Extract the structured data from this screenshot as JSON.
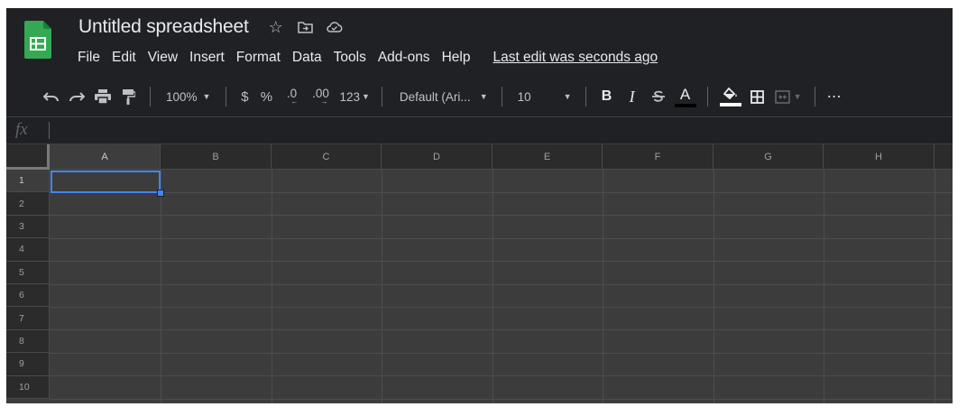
{
  "app": {
    "title": "Untitled spreadsheet",
    "last_edit": "Last edit was seconds ago",
    "accent_color": "#34a853"
  },
  "menu": {
    "items": [
      "File",
      "Edit",
      "View",
      "Insert",
      "Format",
      "Data",
      "Tools",
      "Add-ons",
      "Help"
    ]
  },
  "toolbar": {
    "zoom": "100%",
    "currency": "$",
    "percent": "%",
    "decrease_decimal": ".0",
    "increase_decimal": ".00",
    "more_formats": "123",
    "font": "Default (Ari...",
    "font_size": "10",
    "bold": "B",
    "italic": "I",
    "text_color": "A",
    "more": "⋯",
    "icons": [
      "undo-icon",
      "redo-icon",
      "print-icon",
      "paint-format-icon",
      "strikethrough-icon",
      "text-color-icon",
      "fill-color-icon",
      "borders-icon",
      "merge-cells-icon",
      "more-icon"
    ]
  },
  "formula_bar": {
    "fx_label": "fx",
    "value": ""
  },
  "sheet": {
    "columns": [
      "A",
      "B",
      "C",
      "D",
      "E",
      "F",
      "G",
      "H"
    ],
    "rows": [
      "1",
      "2",
      "3",
      "4",
      "5",
      "6",
      "7",
      "8",
      "9",
      "10"
    ],
    "selected_cell": "A1",
    "selection_color": "#4285f4"
  }
}
